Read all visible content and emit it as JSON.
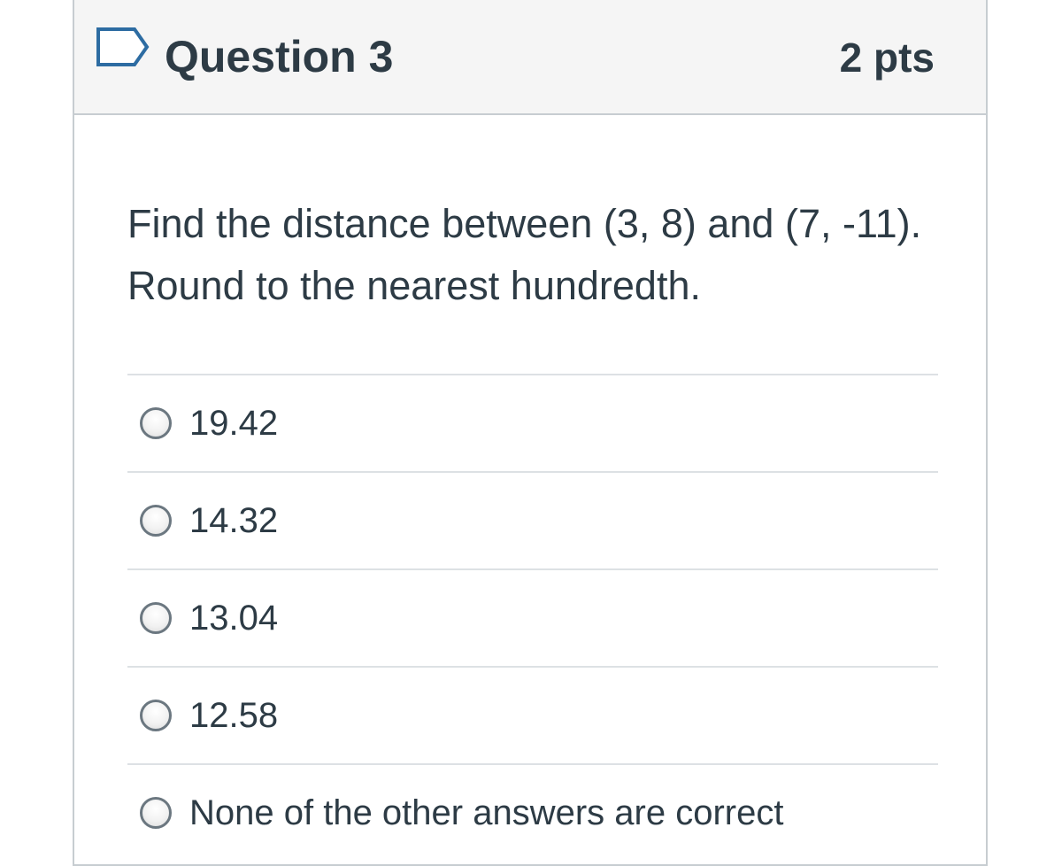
{
  "header": {
    "title": "Question 3",
    "points": "2 pts",
    "flag_icon": "flag-question-icon"
  },
  "question": {
    "line1": "Find the distance between (3, 8) and (7, -11).",
    "line2": "Round to the nearest hundredth."
  },
  "answers": [
    {
      "label": "19.42",
      "selected": false
    },
    {
      "label": "14.32",
      "selected": false
    },
    {
      "label": "13.04",
      "selected": false
    },
    {
      "label": "12.58",
      "selected": false
    },
    {
      "label": "None of the other answers are correct",
      "selected": false
    }
  ],
  "colors": {
    "text": "#2d3b45",
    "header_bg": "#f5f5f5",
    "border": "#c7cdd1",
    "flag": "#2d6ca2"
  }
}
